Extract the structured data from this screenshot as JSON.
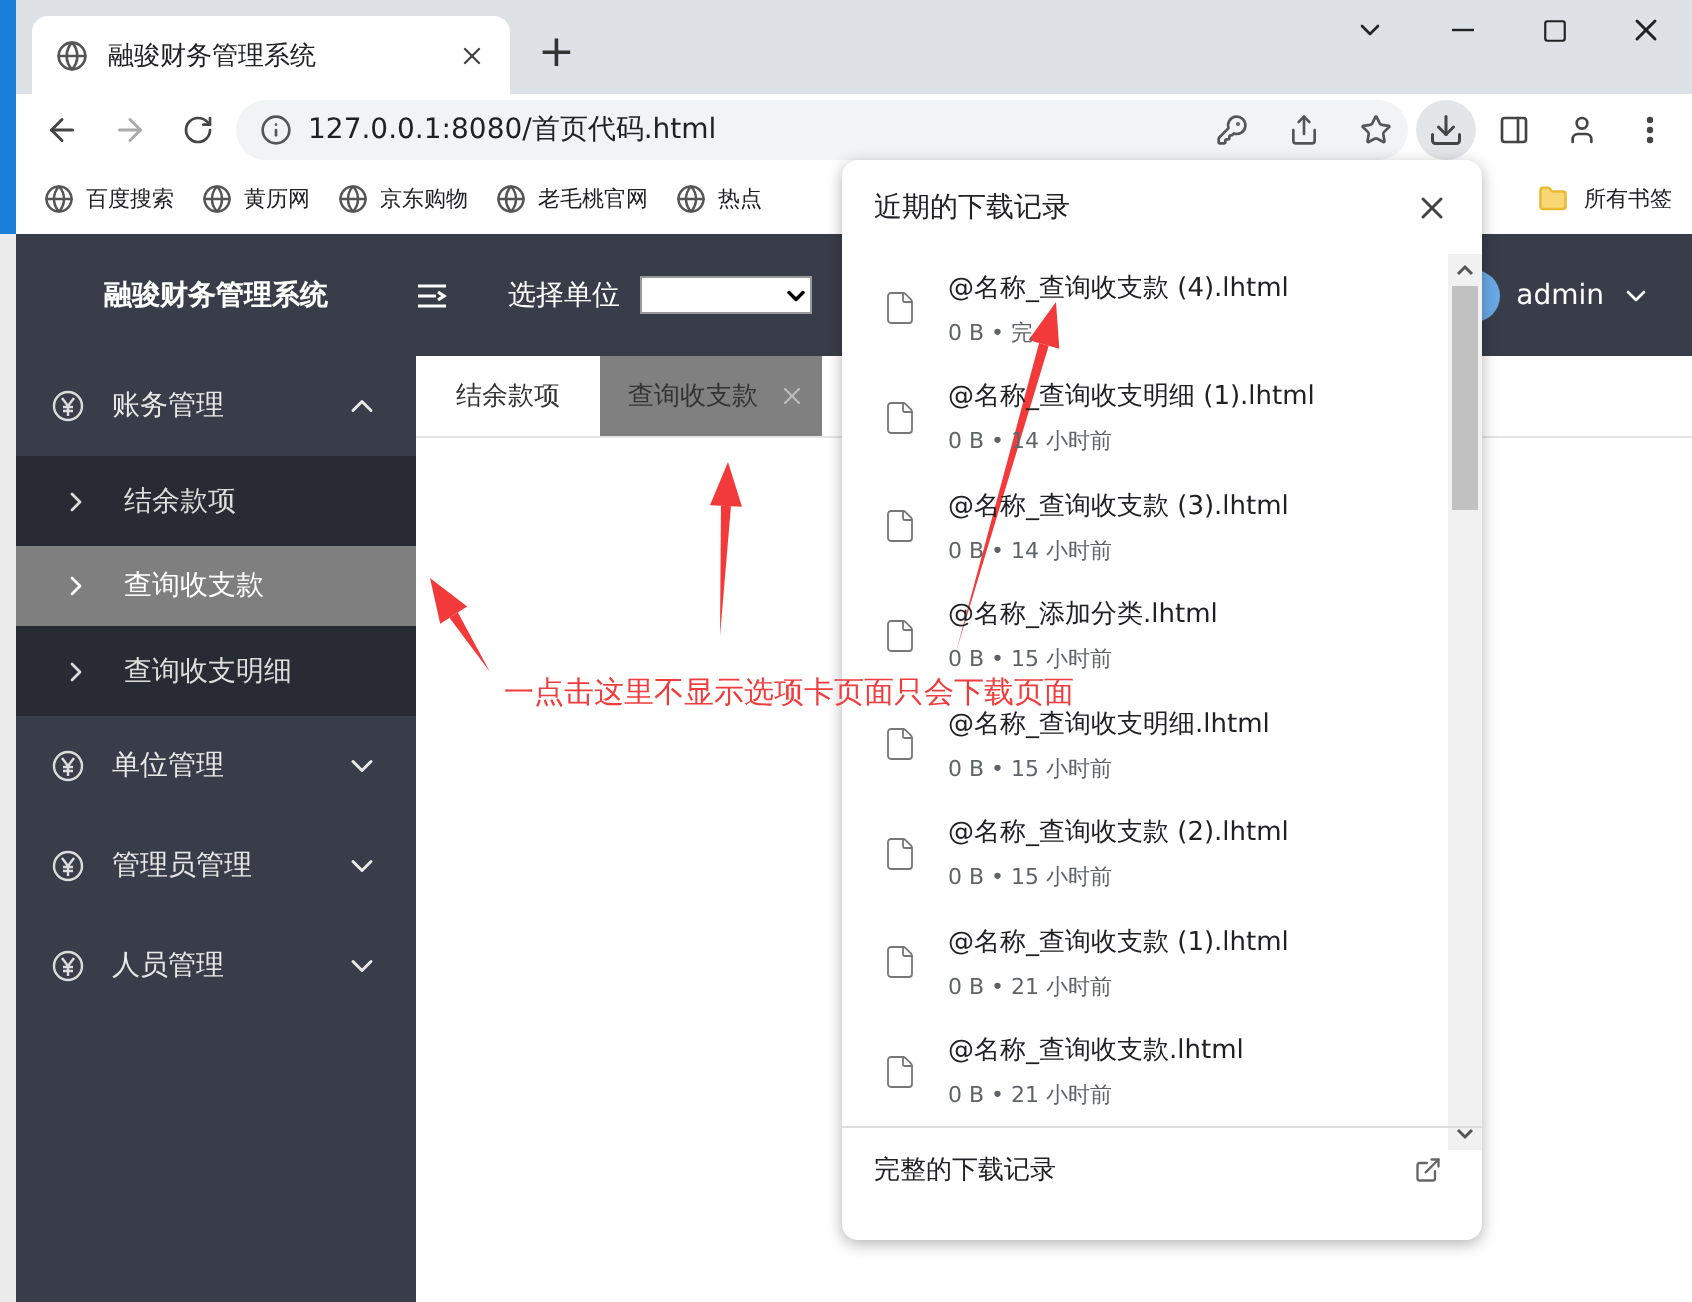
{
  "browser": {
    "tab_title": "融骏财务管理系统",
    "new_tab": "+",
    "url": "127.0.0.1:8080/首页代码.html",
    "bookmarks": [
      "百度搜索",
      "黄历网",
      "京东购物",
      "老毛桃官网",
      "热点"
    ],
    "all_bookmarks": "所有书签"
  },
  "app": {
    "title": "融骏财务管理系统",
    "unit_label": "选择单位",
    "user": "admin",
    "nav": [
      {
        "label": "账务管理",
        "expanded": true,
        "children": [
          {
            "label": "结余款项",
            "selected": false
          },
          {
            "label": "查询收支款",
            "selected": true
          },
          {
            "label": "查询收支明细",
            "selected": false
          }
        ]
      },
      {
        "label": "单位管理",
        "expanded": false
      },
      {
        "label": "管理员管理",
        "expanded": false
      },
      {
        "label": "人员管理",
        "expanded": false
      }
    ],
    "tabs": [
      {
        "label": "结余款项",
        "selected": false,
        "closable": false
      },
      {
        "label": "查询收支款",
        "selected": true,
        "closable": true
      }
    ]
  },
  "downloads": {
    "title": "近期的下载记录",
    "items": [
      {
        "name": "@名称_查询收支款 (4).lhtml",
        "status": "0 B • 完"
      },
      {
        "name": "@名称_查询收支明细 (1).lhtml",
        "status": "0 B • 14 小时前"
      },
      {
        "name": "@名称_查询收支款 (3).lhtml",
        "status": "0 B • 14 小时前"
      },
      {
        "name": "@名称_添加分类.lhtml",
        "status": "0 B • 15 小时前"
      },
      {
        "name": "@名称_查询收支明细.lhtml",
        "status": "0 B • 15 小时前"
      },
      {
        "name": "@名称_查询收支款 (2).lhtml",
        "status": "0 B • 15 小时前"
      },
      {
        "name": "@名称_查询收支款 (1).lhtml",
        "status": "0 B • 21 小时前"
      },
      {
        "name": "@名称_查询收支款.lhtml",
        "status": "0 B • 21 小时前"
      }
    ],
    "footer": "完整的下载记录"
  },
  "annotation": {
    "text": "一点击这里不显示选项卡页面只会下载页面"
  }
}
